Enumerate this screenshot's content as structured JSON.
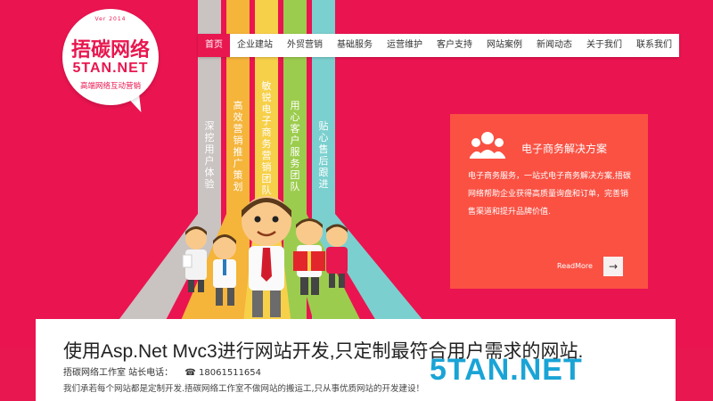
{
  "logo": {
    "version": "Ver 2014",
    "name_cn": "捂碳网络",
    "name_en": "5TAN.NET",
    "tagline": "高端网络互动营销"
  },
  "nav": {
    "items": [
      "首页",
      "企业建站",
      "外贸营销",
      "基础服务",
      "运营维护",
      "客户支持",
      "网站案例",
      "新闻动态",
      "关于我们",
      "联系我们"
    ],
    "active_index": 0
  },
  "stripes": [
    {
      "label": "深挖用户体验",
      "color": "#c9c3c2"
    },
    {
      "label": "高效营销推广策划",
      "color": "#f5b43a"
    },
    {
      "label": "敏锐电子商务营销团队",
      "color": "#f7d04a"
    },
    {
      "label": "用心客户服务团队",
      "color": "#9ccc4e"
    },
    {
      "label": "贴心售后跟进",
      "color": "#7bd0cf"
    }
  ],
  "panel": {
    "icon": "people-group-icon",
    "title": "电子商务解决方案",
    "desc": "电子商务服务，一站式电子商务解决方案,捂碳网络帮助企业获得高质量询盘和订单，完善销售渠道和提升品牌价值.",
    "more_label": "ReadMore",
    "arrow": "→"
  },
  "card": {
    "title": "使用Asp.Net Mvc3进行网站开发,只定制最符合用户需求的网站.",
    "studio": "捂碳网络工作室 站长电话：",
    "phone_icon": "☎",
    "phone": "18061511654",
    "desc": "我们承若每个网站都是定制开发.捂碳网络工作室不做网站的搬运工,只从事优质网站的开发建设！"
  },
  "watermark": "5TAN.NET",
  "colors": {
    "brand": "#e8174f",
    "panel": "#fa5143",
    "watermark": "#1aa4d6"
  }
}
